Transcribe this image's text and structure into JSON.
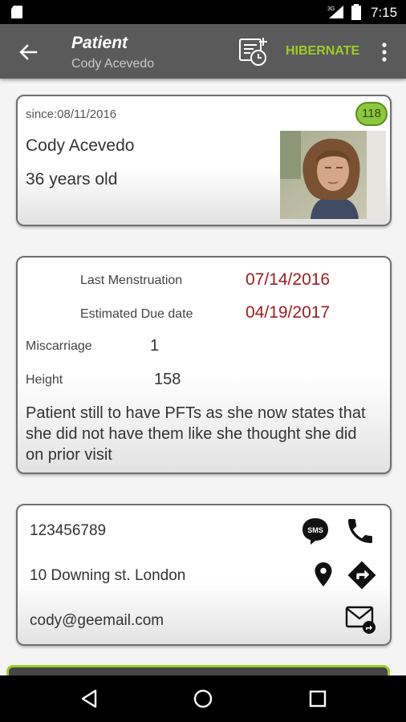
{
  "status_bar": {
    "time": "7:15",
    "network": "3G"
  },
  "app_bar": {
    "title": "Patient",
    "subtitle": "Cody Acevedo",
    "hibernate_label": "HIBERNATE",
    "icons": [
      "back-arrow-icon",
      "schedule-icon",
      "overflow-menu-icon"
    ]
  },
  "patient_card": {
    "since": "since:08/11/2016",
    "badge": "118",
    "name": "Cody Acevedo",
    "age": "36 years old",
    "badge_color": "#8dc63f"
  },
  "pregnancy_card": {
    "last_menstruation_label": "Last Menstruation",
    "last_menstruation_value": "07/14/2016",
    "due_date_label": "Estimated Due date",
    "due_date_value": "04/19/2017",
    "miscarriage_label": "Miscarriage",
    "miscarriage_value": "1",
    "height_label": "Height",
    "height_value": "158",
    "notes": "Patient still to have PFTs as she now states that she did not have them like she thought she did on prior visit",
    "accent_color": "#9b1c1c"
  },
  "contact_card": {
    "phone": "123456789",
    "address": "10 Downing st. London",
    "email": "cody@geemail.com",
    "sms_label": "SMS",
    "icons": [
      "sms-icon",
      "phone-icon",
      "location-icon",
      "directions-icon",
      "email-icon"
    ]
  },
  "colors": {
    "app_bar": "#5a5a5a",
    "accent_green": "#9ccc2a"
  }
}
